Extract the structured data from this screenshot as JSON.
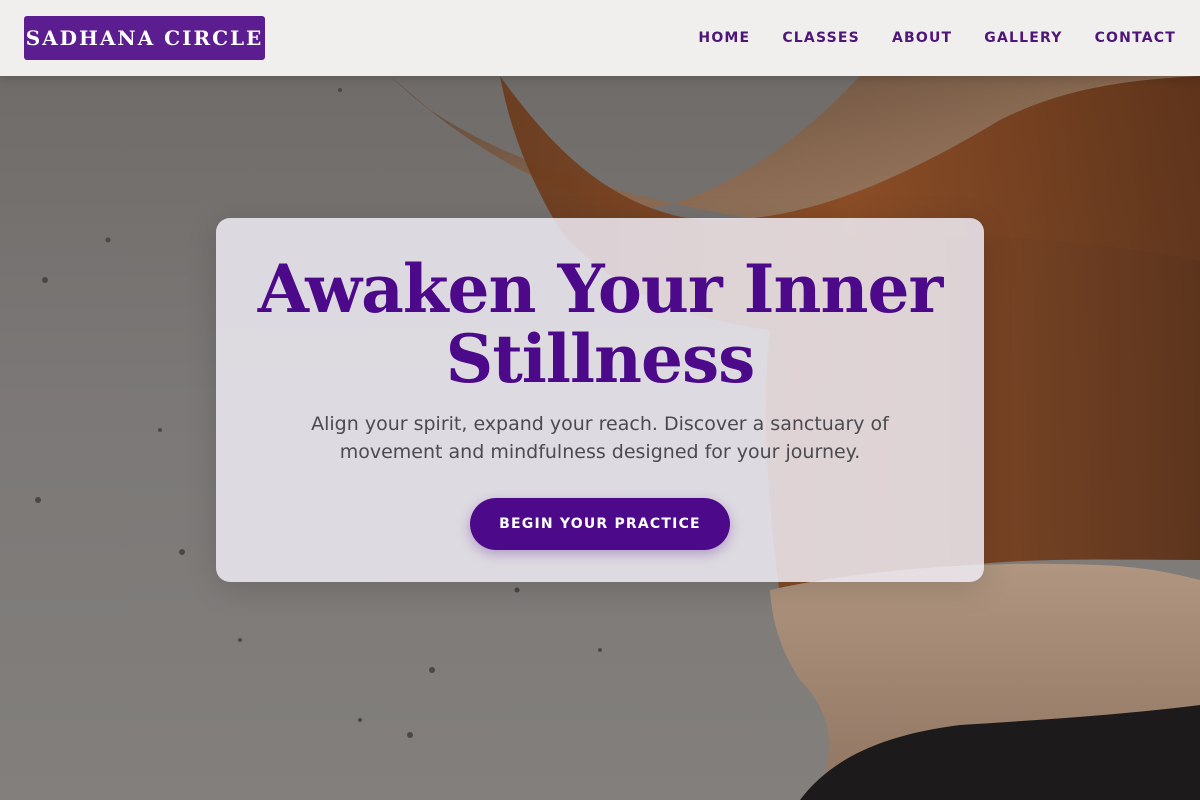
{
  "brand": {
    "name": "SADHANA CIRCLE",
    "accent_color": "#5b1d8f",
    "primary_color": "#4c0a8a"
  },
  "nav": {
    "items": [
      {
        "label": "HOME"
      },
      {
        "label": "CLASSES"
      },
      {
        "label": "ABOUT"
      },
      {
        "label": "GALLERY"
      },
      {
        "label": "CONTACT"
      }
    ]
  },
  "hero": {
    "title": "Awaken Your Inner Stillness",
    "subtitle": "Align your spirit, expand your reach. Discover a sanctuary of movement and mindfulness designed for your journey.",
    "cta_label": "BEGIN YOUR PRACTICE",
    "background_image": "person-with-orange-scarf-photo"
  }
}
